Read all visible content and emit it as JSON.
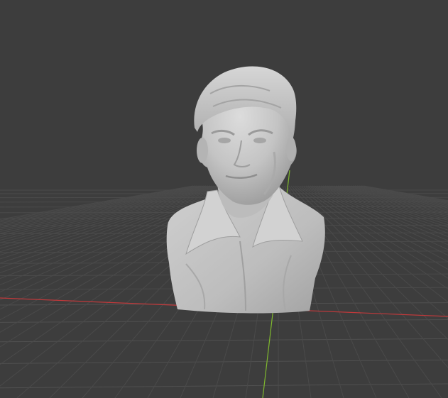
{
  "viewport": {
    "background": "#3d3d3d",
    "grid_color": "#4a4a4a",
    "grid_color_near": "#505050",
    "x_axis_color": "#c0393b",
    "y_axis_color": "#7fb82e",
    "grid_visible": true
  },
  "object": {
    "name": "",
    "material_color": "#c8c8c8",
    "shading": "solid"
  }
}
